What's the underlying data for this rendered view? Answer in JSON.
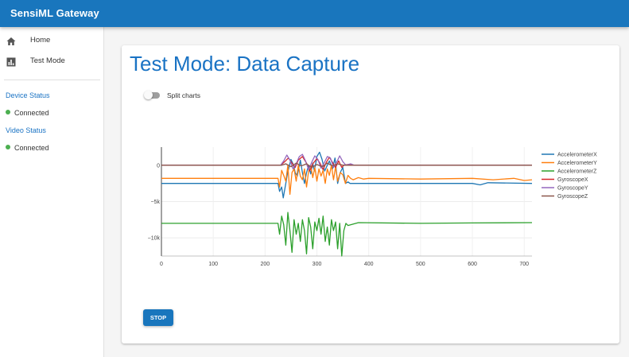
{
  "app": {
    "title": "SensiML Gateway"
  },
  "sidebar": {
    "items": [
      {
        "label": "Home",
        "icon": "home-icon"
      },
      {
        "label": "Test Mode",
        "icon": "chart-icon"
      }
    ],
    "device_status": {
      "heading": "Device Status",
      "value": "Connected",
      "color": "#4caf50"
    },
    "video_status": {
      "heading": "Video Status",
      "value": "Connected",
      "color": "#4caf50"
    }
  },
  "main": {
    "title": "Test Mode: Data Capture",
    "split_toggle": {
      "label": "Split charts",
      "checked": false
    },
    "stop_label": "STOP"
  },
  "colors": {
    "primary": "#1976bd",
    "title": "#1a73c4"
  },
  "chart_data": {
    "type": "line",
    "xlim": [
      0,
      715
    ],
    "ylim": [
      -12500,
      2500
    ],
    "x_ticks": [
      "0",
      "100",
      "200",
      "300",
      "400",
      "500",
      "600",
      "700"
    ],
    "y_ticks": [
      "0",
      "−5k",
      "−10k"
    ],
    "y_tick_values": [
      0,
      -5000,
      -10000
    ],
    "grid": true,
    "legend": "right",
    "series": [
      {
        "name": "AccelerometerX",
        "color": "#1f77b4",
        "points": [
          [
            0,
            -2500
          ],
          [
            225,
            -2500
          ],
          [
            228,
            -3600
          ],
          [
            232,
            -3000
          ],
          [
            235,
            -4500
          ],
          [
            240,
            -2500
          ],
          [
            243,
            -1200
          ],
          [
            247,
            0
          ],
          [
            250,
            800
          ],
          [
            255,
            0
          ],
          [
            258,
            -1000
          ],
          [
            262,
            -1500
          ],
          [
            268,
            700
          ],
          [
            272,
            -1000
          ],
          [
            276,
            -2500
          ],
          [
            280,
            -1000
          ],
          [
            284,
            0
          ],
          [
            288,
            -1200
          ],
          [
            292,
            300
          ],
          [
            295,
            -800
          ],
          [
            300,
            1200
          ],
          [
            305,
            1800
          ],
          [
            310,
            800
          ],
          [
            315,
            -800
          ],
          [
            320,
            0
          ],
          [
            324,
            600
          ],
          [
            330,
            -500
          ],
          [
            335,
            1000
          ],
          [
            340,
            -2500
          ],
          [
            345,
            -1000
          ],
          [
            350,
            -300
          ],
          [
            355,
            -2500
          ],
          [
            360,
            -2300
          ],
          [
            364,
            -2500
          ],
          [
            380,
            -2500
          ],
          [
            600,
            -2500
          ],
          [
            615,
            -2700
          ],
          [
            630,
            -2400
          ],
          [
            715,
            -2500
          ]
        ]
      },
      {
        "name": "AccelerometerY",
        "color": "#ff7f0e",
        "points": [
          [
            0,
            -1800
          ],
          [
            225,
            -1800
          ],
          [
            228,
            -3000
          ],
          [
            232,
            -700
          ],
          [
            236,
            -1400
          ],
          [
            240,
            -2200
          ],
          [
            244,
            0
          ],
          [
            248,
            -4000
          ],
          [
            252,
            -1000
          ],
          [
            256,
            -500
          ],
          [
            260,
            -2200
          ],
          [
            264,
            0
          ],
          [
            268,
            -1500
          ],
          [
            272,
            -2000
          ],
          [
            276,
            -500
          ],
          [
            280,
            -3000
          ],
          [
            284,
            -800
          ],
          [
            288,
            0
          ],
          [
            292,
            -1700
          ],
          [
            296,
            -300
          ],
          [
            300,
            -2200
          ],
          [
            304,
            -500
          ],
          [
            308,
            -1500
          ],
          [
            312,
            -700
          ],
          [
            316,
            -2500
          ],
          [
            320,
            -500
          ],
          [
            324,
            -1400
          ],
          [
            328,
            0
          ],
          [
            332,
            -2000
          ],
          [
            336,
            -200
          ],
          [
            340,
            -2200
          ],
          [
            345,
            -1000
          ],
          [
            350,
            -1300
          ],
          [
            355,
            -2500
          ],
          [
            360,
            -1400
          ],
          [
            365,
            -1800
          ],
          [
            370,
            -2000
          ],
          [
            380,
            -1700
          ],
          [
            390,
            -1900
          ],
          [
            400,
            -1800
          ],
          [
            500,
            -1900
          ],
          [
            600,
            -1800
          ],
          [
            640,
            -2000
          ],
          [
            680,
            -1800
          ],
          [
            700,
            -2100
          ],
          [
            715,
            -2000
          ]
        ]
      },
      {
        "name": "AccelerometerZ",
        "color": "#2ca02c",
        "points": [
          [
            0,
            -8000
          ],
          [
            225,
            -8000
          ],
          [
            228,
            -9500
          ],
          [
            232,
            -7000
          ],
          [
            236,
            -8200
          ],
          [
            240,
            -11000
          ],
          [
            244,
            -6500
          ],
          [
            248,
            -9000
          ],
          [
            252,
            -12000
          ],
          [
            256,
            -7500
          ],
          [
            260,
            -9500
          ],
          [
            264,
            -8000
          ],
          [
            268,
            -10500
          ],
          [
            272,
            -7500
          ],
          [
            276,
            -9000
          ],
          [
            280,
            -12200
          ],
          [
            284,
            -7200
          ],
          [
            288,
            -8500
          ],
          [
            292,
            -11500
          ],
          [
            296,
            -7800
          ],
          [
            300,
            -9000
          ],
          [
            304,
            -7300
          ],
          [
            308,
            -9500
          ],
          [
            312,
            -7000
          ],
          [
            316,
            -10500
          ],
          [
            320,
            -8500
          ],
          [
            324,
            -11000
          ],
          [
            328,
            -7500
          ],
          [
            332,
            -9000
          ],
          [
            336,
            -7800
          ],
          [
            340,
            -11500
          ],
          [
            344,
            -8000
          ],
          [
            348,
            -12500
          ],
          [
            352,
            -9000
          ],
          [
            356,
            -8000
          ],
          [
            360,
            -8300
          ],
          [
            380,
            -7900
          ],
          [
            500,
            -8000
          ],
          [
            600,
            -7950
          ],
          [
            715,
            -7900
          ]
        ]
      },
      {
        "name": "GyroscopeX",
        "color": "#d62728",
        "points": [
          [
            0,
            0
          ],
          [
            230,
            0
          ],
          [
            238,
            500
          ],
          [
            245,
            1000
          ],
          [
            252,
            300
          ],
          [
            258,
            -300
          ],
          [
            264,
            700
          ],
          [
            272,
            1200
          ],
          [
            280,
            300
          ],
          [
            286,
            -800
          ],
          [
            292,
            200
          ],
          [
            300,
            900
          ],
          [
            306,
            300
          ],
          [
            312,
            -600
          ],
          [
            318,
            400
          ],
          [
            324,
            1100
          ],
          [
            330,
            400
          ],
          [
            336,
            -300
          ],
          [
            342,
            600
          ],
          [
            348,
            -300
          ],
          [
            352,
            0
          ],
          [
            360,
            100
          ],
          [
            370,
            0
          ],
          [
            715,
            0
          ]
        ]
      },
      {
        "name": "GyroscopeY",
        "color": "#9467bd",
        "points": [
          [
            0,
            0
          ],
          [
            230,
            0
          ],
          [
            236,
            600
          ],
          [
            242,
            1400
          ],
          [
            248,
            700
          ],
          [
            254,
            -500
          ],
          [
            260,
            200
          ],
          [
            266,
            1200
          ],
          [
            272,
            1500
          ],
          [
            278,
            600
          ],
          [
            284,
            -600
          ],
          [
            290,
            400
          ],
          [
            296,
            1300
          ],
          [
            302,
            800
          ],
          [
            308,
            -400
          ],
          [
            314,
            300
          ],
          [
            320,
            1200
          ],
          [
            326,
            1000
          ],
          [
            332,
            -300
          ],
          [
            338,
            400
          ],
          [
            344,
            1300
          ],
          [
            350,
            500
          ],
          [
            356,
            0
          ],
          [
            365,
            200
          ],
          [
            372,
            0
          ],
          [
            715,
            0
          ]
        ]
      },
      {
        "name": "GyroscopeZ",
        "color": "#8c564b",
        "points": [
          [
            0,
            0
          ],
          [
            232,
            0
          ],
          [
            240,
            200
          ],
          [
            250,
            -200
          ],
          [
            260,
            300
          ],
          [
            270,
            -100
          ],
          [
            280,
            200
          ],
          [
            290,
            -300
          ],
          [
            300,
            100
          ],
          [
            310,
            -200
          ],
          [
            320,
            300
          ],
          [
            330,
            -100
          ],
          [
            340,
            200
          ],
          [
            350,
            0
          ],
          [
            715,
            0
          ]
        ]
      }
    ]
  }
}
